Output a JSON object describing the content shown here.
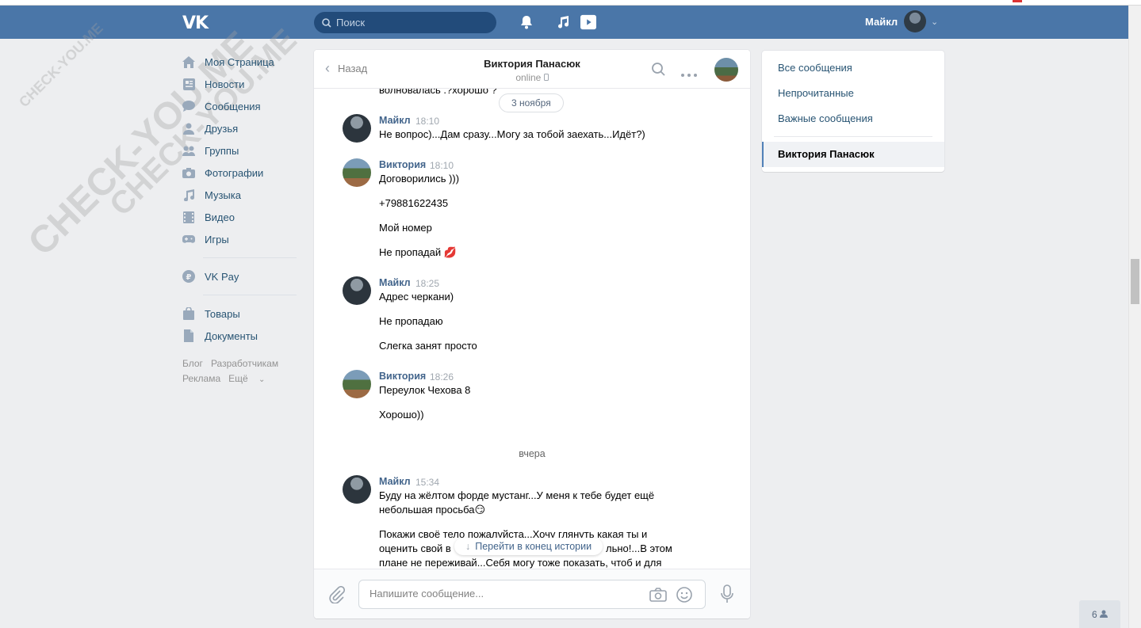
{
  "header": {
    "logo_text": "VK",
    "search_placeholder": "Поиск",
    "username": "Майкл"
  },
  "watermark": [
    "CHECK-YOU.ME",
    "CHECK-YOU.ME",
    "CHECK-YOU.ME"
  ],
  "left_nav": {
    "items": [
      {
        "label": "Моя Страница",
        "icon": "home-icon"
      },
      {
        "label": "Новости",
        "icon": "news-icon"
      },
      {
        "label": "Сообщения",
        "icon": "messages-icon"
      },
      {
        "label": "Друзья",
        "icon": "friends-icon"
      },
      {
        "label": "Группы",
        "icon": "groups-icon"
      },
      {
        "label": "Фотографии",
        "icon": "photos-icon"
      },
      {
        "label": "Музыка",
        "icon": "music-icon"
      },
      {
        "label": "Видео",
        "icon": "video-icon"
      },
      {
        "label": "Игры",
        "icon": "games-icon"
      }
    ],
    "vkpay": "VK Pay",
    "goods": "Товары",
    "docs": "Документы",
    "footer": {
      "blog": "Блог",
      "dev": "Разработчикам",
      "ads": "Реклама",
      "more": "Ещё"
    }
  },
  "chat": {
    "back_label": "Назад",
    "peer_name": "Виктория Панасюк",
    "peer_status": "online",
    "date_pill": "3 ноября",
    "cut_text": "волновалась .?хорошо ?",
    "messages": [
      {
        "author": "Майкл",
        "time": "18:10",
        "lines": [
          "Не вопрос)...Дам сразу...Могу за тобой заехать...Идёт?)"
        ]
      },
      {
        "author": "Виктория",
        "time": "18:10",
        "lines": [
          "Договорились )))",
          "+79881622435",
          "Мой номер",
          "Не пропадай 💋"
        ]
      },
      {
        "author": "Майкл",
        "time": "18:25",
        "lines": [
          "Адрес черкани)",
          "Не пропадаю",
          "Слегка занят просто"
        ]
      },
      {
        "author": "Виктория",
        "time": "18:26",
        "lines": [
          "Переулок Чехова 8",
          "Хорошо))"
        ]
      },
      {
        "author": "Майкл",
        "time": "15:34",
        "lines": [
          "Буду на жёлтом форде мустанг...У меня к тебе будет ещё",
          "небольшая просьба😏",
          "Покажи своё тело пожалуйста...Хочу глянуть какая ты и",
          "оценить свой в",
          "льно!...В этом",
          "плане не переживай...Себя могу тоже показать, чтоб и для"
        ]
      }
    ],
    "day_label": "вчера",
    "jump_label": "Перейти в конец истории",
    "composer_placeholder": "Напишите сообщение..."
  },
  "right_menu": {
    "all": "Все сообщения",
    "unread": "Непрочитанные",
    "important": "Важные сообщения",
    "active": "Виктория Панасюк"
  },
  "online_count": "6"
}
